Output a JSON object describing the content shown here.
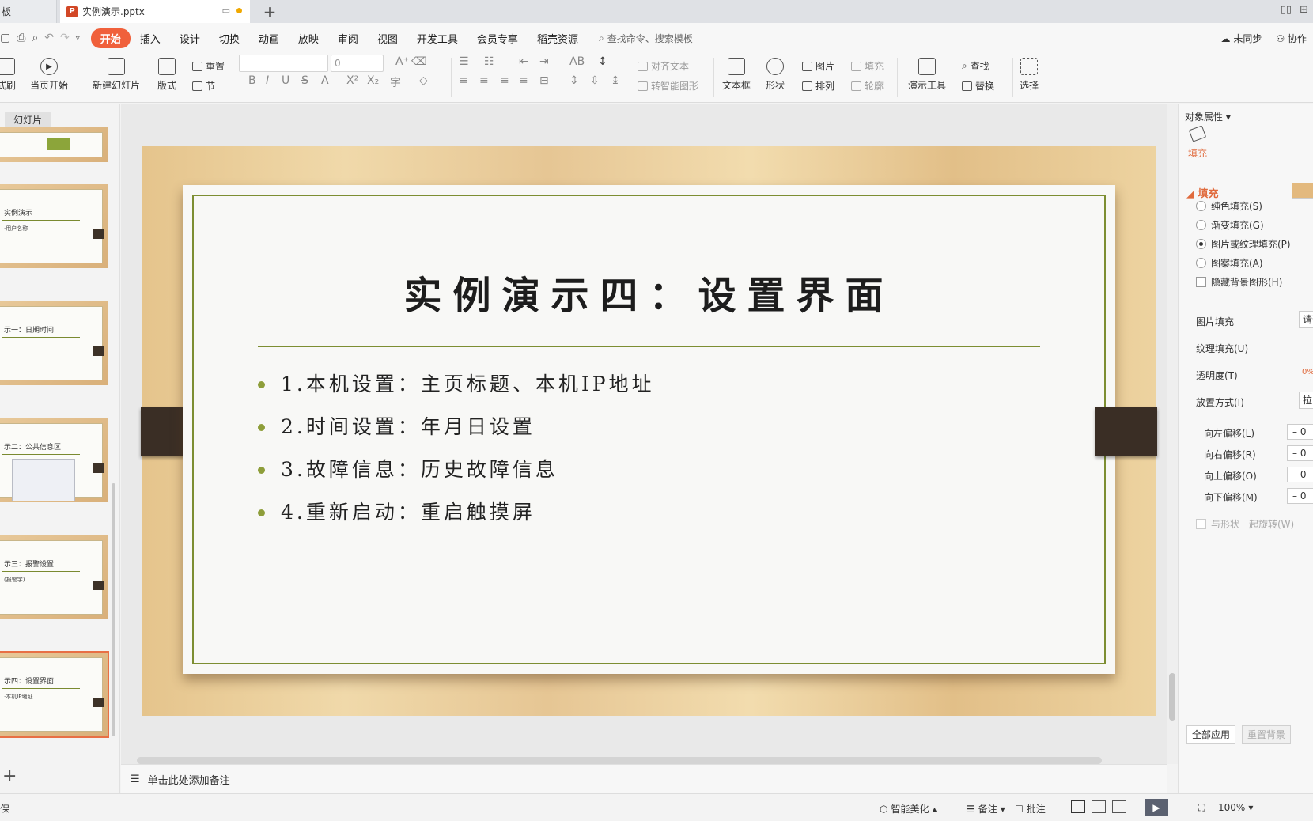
{
  "tabs": {
    "prev_label": "板",
    "doc_label": "实例演示.pptx",
    "ppt_icon": "P"
  },
  "menu": {
    "items": [
      "开始",
      "插入",
      "设计",
      "切换",
      "动画",
      "放映",
      "审阅",
      "视图",
      "开发工具",
      "会员专享",
      "稻壳资源"
    ],
    "search_placeholder": "查找命令、搜索模板",
    "sync_label": "未同步",
    "collab_label": "协作"
  },
  "ribbon": {
    "partial_left": "式刷",
    "play_from_current": "当页开始",
    "new_slide": "新建幻灯片",
    "layout": "版式",
    "reset": "重置",
    "section": "节",
    "font_size": "0",
    "align_text": "对齐文本",
    "smart_shape": "转智能图形",
    "textbox": "文本框",
    "shape": "形状",
    "picture": "图片",
    "arrange": "排列",
    "fill": "填充",
    "outline": "轮廓",
    "presenter_tools": "演示工具",
    "find": "查找",
    "replace": "替换",
    "select": "选择"
  },
  "thumbnails": {
    "pane_tab": "幻灯片",
    "slides": [
      {
        "title": "",
        "sub": ""
      },
      {
        "title": "实例演示",
        "sub": "·用户名称"
      },
      {
        "title": "示一：日期时间",
        "sub": ""
      },
      {
        "title": "示二：公共信息区",
        "sub": ""
      },
      {
        "title": "示三：报警设置",
        "sub": "(报警字)"
      },
      {
        "title": "示四：设置界面",
        "sub": "·本机IP地址"
      }
    ]
  },
  "slide": {
    "title": "实例演示四：设置界面",
    "bullets": [
      "1.本机设置：主页标题、本机IP地址",
      "2.时间设置：年月日设置",
      "3.故障信息：历史故障信息",
      "4.重新启动：重启触摸屏"
    ]
  },
  "notes": {
    "placeholder": "单击此处添加备注"
  },
  "props": {
    "header": "对象属性",
    "tab_fill": "填充",
    "section_fill": "填充",
    "options": [
      "纯色填充(S)",
      "渐变填充(G)",
      "图片或纹理填充(P)",
      "图案填充(A)"
    ],
    "selected_option": "图片或纹理填充(P)",
    "hide_bg_shapes": "隐藏背景图形(H)",
    "picture_fill": "图片填充",
    "picture_fill_value": "请选",
    "texture_fill": "纹理填充(U)",
    "transparency": "透明度(T)",
    "transparency_value": "0%",
    "placement": "放置方式(I)",
    "placement_value": "拉",
    "offsets": [
      "向左偏移(L)",
      "向右偏移(R)",
      "向上偏移(O)",
      "向下偏移(M)"
    ],
    "offset_value": "– 0",
    "rotate_with_shape": "与形状一起旋转(W)",
    "apply_all": "全部应用",
    "reset_bg": "重置背景"
  },
  "status": {
    "left": "保",
    "smart_beautify": "智能美化",
    "notes": "备注",
    "comments": "批注",
    "zoom": "100%"
  },
  "colors": {
    "accent": "#f0603b",
    "paper_border": "#7d8e32",
    "wood": "#e5c48c",
    "clip": "#3a2e25"
  }
}
